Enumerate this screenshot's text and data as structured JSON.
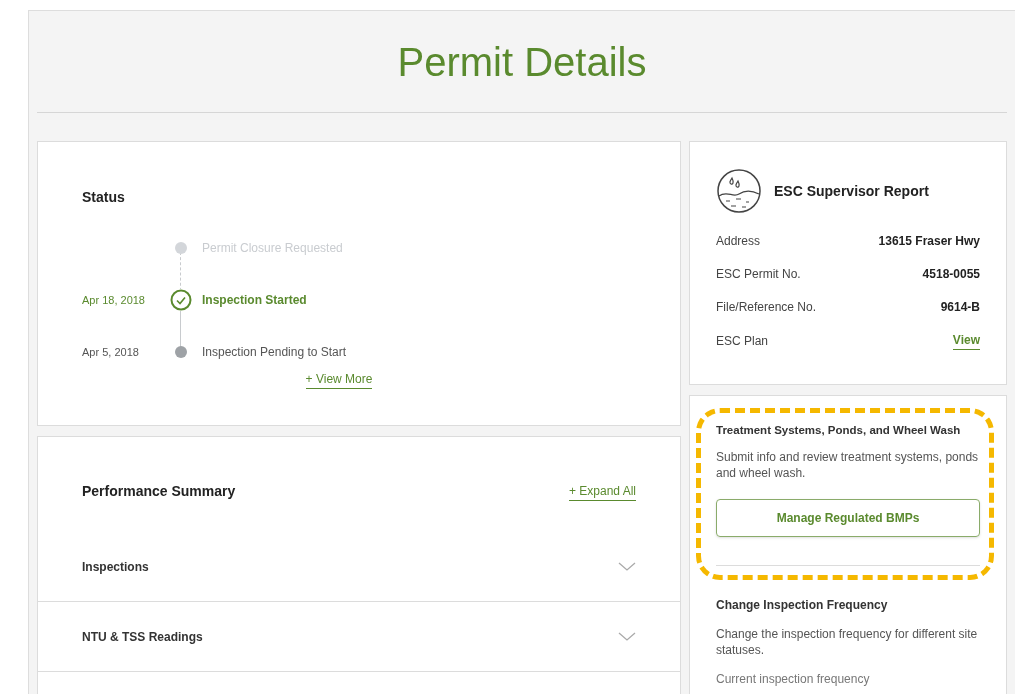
{
  "page": {
    "title": "Permit Details"
  },
  "status": {
    "heading": "Status",
    "events": [
      {
        "label": "Permit Closure Requested",
        "kind": "future"
      },
      {
        "date": "Apr 18, 2018",
        "label": "Inspection Started",
        "kind": "current"
      },
      {
        "date": "Apr 5, 2018",
        "label": "Inspection Pending to Start",
        "kind": "past"
      }
    ],
    "view_more": "+ View More"
  },
  "performance": {
    "heading": "Performance Summary",
    "expand_all": "+ Expand All",
    "sections": [
      {
        "label": "Inspections",
        "expanded": false
      },
      {
        "label": "NTU & TSS Readings",
        "expanded": false
      }
    ]
  },
  "report": {
    "title": "ESC Supervisor Report",
    "rows": [
      {
        "label": "Address",
        "value": "13615 Fraser Hwy",
        "kind": "text"
      },
      {
        "label": "ESC Permit No.",
        "value": "4518-0055",
        "kind": "text"
      },
      {
        "label": "File/Reference No.",
        "value": "9614-B",
        "kind": "text"
      },
      {
        "label": "ESC Plan",
        "value": "View",
        "kind": "link"
      }
    ]
  },
  "treatment": {
    "title": "Treatment Systems, Ponds, and Wheel Wash",
    "description": "Submit info and review treatment systems, ponds and wheel wash.",
    "button": "Manage Regulated BMPs",
    "highlighted": true
  },
  "frequency": {
    "title": "Change Inspection Frequency",
    "description": "Change the inspection frequency for different site statuses.",
    "current_label": "Current inspection frequency"
  }
}
